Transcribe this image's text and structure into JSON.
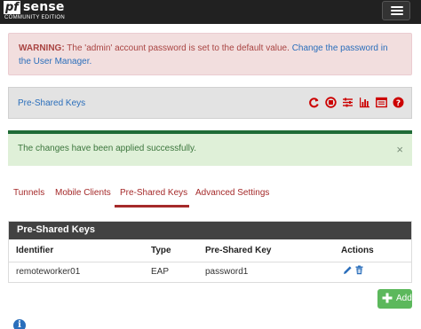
{
  "brand": {
    "logo_pf": "pf",
    "logo_sense": "sense",
    "logo_edition": "COMMUNITY EDITION"
  },
  "warning": {
    "prefix": "WARNING:",
    "message": " The 'admin' account password is set to the default value. ",
    "link": "Change the password in the User Manager."
  },
  "page": {
    "title": "Pre-Shared Keys",
    "icons": [
      "restart-icon",
      "stop-icon",
      "sliders-icon",
      "chart-icon",
      "list-icon",
      "help-icon"
    ]
  },
  "success": {
    "message": "The changes have been applied successfully.",
    "close": "×"
  },
  "tabs": [
    {
      "label": "Tunnels",
      "active": false
    },
    {
      "label": "Mobile Clients",
      "active": false
    },
    {
      "label": "Pre-Shared Keys",
      "active": true
    },
    {
      "label": "Advanced Settings",
      "active": false
    }
  ],
  "keys_table": {
    "heading": "Pre-Shared Keys",
    "columns": [
      "Identifier",
      "Type",
      "Pre-Shared Key",
      "Actions"
    ],
    "rows": [
      {
        "identifier": "remoteworker01",
        "type": "EAP",
        "key": "password1"
      }
    ]
  },
  "add_button": {
    "label": "Add"
  },
  "colors": {
    "navbar": "#212121",
    "accent_red": "#a52a2a",
    "link_blue": "#2a6ebb",
    "success_green": "#5cb85c"
  }
}
